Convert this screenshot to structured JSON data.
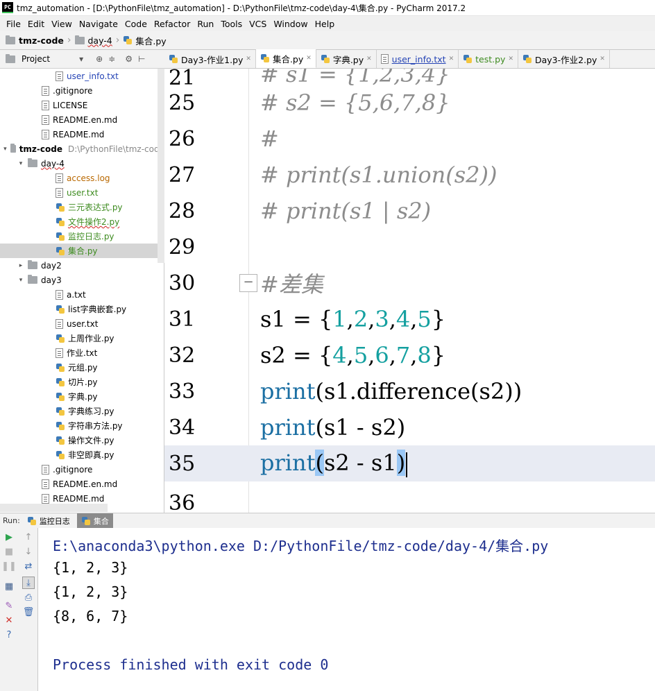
{
  "window": {
    "title": "tmz_automation - [D:\\PythonFile\\tmz_automation] - D:\\PythonFile\\tmz-code\\day-4\\集合.py - PyCharm 2017.2",
    "app_icon": "PC"
  },
  "menu": [
    {
      "label": "File"
    },
    {
      "label": "Edit"
    },
    {
      "label": "View"
    },
    {
      "label": "Navigate"
    },
    {
      "label": "Code"
    },
    {
      "label": "Refactor"
    },
    {
      "label": "Run"
    },
    {
      "label": "Tools"
    },
    {
      "label": "VCS"
    },
    {
      "label": "Window"
    },
    {
      "label": "Help"
    }
  ],
  "breadcrumb": [
    "tmz-code",
    "day-4",
    "集合.py"
  ],
  "project_panel": {
    "title": "Project",
    "tree": [
      {
        "label": "user_info.txt",
        "indent": 3,
        "icon": "txt-icon",
        "color": "blue"
      },
      {
        "label": ".gitignore",
        "indent": 2,
        "icon": "txt-icon"
      },
      {
        "label": "LICENSE",
        "indent": 2,
        "icon": "txt-icon"
      },
      {
        "label": "README.en.md",
        "indent": 2,
        "icon": "txt-icon"
      },
      {
        "label": "README.md",
        "indent": 2,
        "icon": "txt-icon"
      },
      {
        "label": "tmz-code",
        "indent": 0,
        "icon": "folder-icon",
        "arrow": "▾",
        "bold": true,
        "hint": "D:\\PythonFile\\tmz-code"
      },
      {
        "label": "day-4",
        "indent": 1,
        "icon": "folder-icon",
        "arrow": "▾",
        "wavy": true
      },
      {
        "label": "access.log",
        "indent": 3,
        "icon": "txt-icon",
        "color": "orange"
      },
      {
        "label": "user.txt",
        "indent": 3,
        "icon": "txt-icon",
        "color": "green"
      },
      {
        "label": "三元表达式.py",
        "indent": 3,
        "icon": "py-icon",
        "color": "green"
      },
      {
        "label": "文件操作2.py",
        "indent": 3,
        "icon": "py-icon",
        "color": "green",
        "wavy": true
      },
      {
        "label": "监控日志.py",
        "indent": 3,
        "icon": "py-icon",
        "color": "green"
      },
      {
        "label": "集合.py",
        "indent": 3,
        "icon": "py-icon",
        "color": "green",
        "selected": true
      },
      {
        "label": "day2",
        "indent": 1,
        "icon": "folder-icon",
        "arrow": "▸"
      },
      {
        "label": "day3",
        "indent": 1,
        "icon": "folder-icon",
        "arrow": "▾"
      },
      {
        "label": "a.txt",
        "indent": 3,
        "icon": "txt-icon"
      },
      {
        "label": "list字典嵌套.py",
        "indent": 3,
        "icon": "py-icon"
      },
      {
        "label": "user.txt",
        "indent": 3,
        "icon": "txt-icon"
      },
      {
        "label": "上周作业.py",
        "indent": 3,
        "icon": "py-icon"
      },
      {
        "label": "作业.txt",
        "indent": 3,
        "icon": "txt-icon"
      },
      {
        "label": "元组.py",
        "indent": 3,
        "icon": "py-icon"
      },
      {
        "label": "切片.py",
        "indent": 3,
        "icon": "py-icon"
      },
      {
        "label": "字典.py",
        "indent": 3,
        "icon": "py-icon"
      },
      {
        "label": "字典练习.py",
        "indent": 3,
        "icon": "py-icon"
      },
      {
        "label": "字符串方法.py",
        "indent": 3,
        "icon": "py-icon"
      },
      {
        "label": "操作文件.py",
        "indent": 3,
        "icon": "py-icon"
      },
      {
        "label": "非空即真.py",
        "indent": 3,
        "icon": "py-icon"
      },
      {
        "label": ".gitignore",
        "indent": 2,
        "icon": "txt-icon"
      },
      {
        "label": "README.en.md",
        "indent": 2,
        "icon": "txt-icon"
      },
      {
        "label": "README.md",
        "indent": 2,
        "icon": "txt-icon"
      }
    ]
  },
  "editor_tabs": [
    {
      "label": "Day3-作业1.py",
      "icon": "py-icon"
    },
    {
      "label": "集合.py",
      "icon": "py-icon",
      "active": true
    },
    {
      "label": "字典.py",
      "icon": "py-icon"
    },
    {
      "label": "user_info.txt",
      "icon": "txt-icon",
      "color": "blue"
    },
    {
      "label": "test.py",
      "icon": "py-icon",
      "color": "green"
    },
    {
      "label": "Day3-作业2.py",
      "icon": "py-icon"
    }
  ],
  "editor": {
    "lines": [
      {
        "num": "25",
        "tokens": [
          [
            "cm",
            "# s2 = {5,6,7,8}"
          ]
        ]
      },
      {
        "num": "26",
        "tokens": [
          [
            "cm",
            "#"
          ]
        ]
      },
      {
        "num": "27",
        "tokens": [
          [
            "cm",
            "# print(s1.union(s2))"
          ]
        ]
      },
      {
        "num": "28",
        "tokens": [
          [
            "cm",
            "# print(s1 | s2)"
          ]
        ]
      },
      {
        "num": "29",
        "tokens": []
      },
      {
        "num": "30",
        "tokens": [
          [
            "cm",
            "#差集"
          ]
        ],
        "fold": true
      },
      {
        "num": "31",
        "tokens": [
          [
            "",
            "s1 = {"
          ],
          [
            "num",
            "1"
          ],
          [
            "",
            ","
          ],
          [
            "num",
            "2"
          ],
          [
            "",
            ","
          ],
          [
            "num",
            "3"
          ],
          [
            "",
            ","
          ],
          [
            "num",
            "4"
          ],
          [
            "",
            ","
          ],
          [
            "num",
            "5"
          ],
          [
            "",
            "}"
          ]
        ]
      },
      {
        "num": "32",
        "tokens": [
          [
            "",
            "s2 = {"
          ],
          [
            "num",
            "4"
          ],
          [
            "",
            ","
          ],
          [
            "num",
            "5"
          ],
          [
            "",
            ","
          ],
          [
            "num",
            "6"
          ],
          [
            "",
            ","
          ],
          [
            "num",
            "7"
          ],
          [
            "",
            ","
          ],
          [
            "num",
            "8"
          ],
          [
            "",
            "}"
          ]
        ]
      },
      {
        "num": "33",
        "tokens": [
          [
            "kw",
            "print"
          ],
          [
            "",
            "(s1.difference(s2))"
          ]
        ]
      },
      {
        "num": "34",
        "tokens": [
          [
            "kw",
            "print"
          ],
          [
            "",
            "(s1 - s2)"
          ]
        ]
      },
      {
        "num": "35",
        "tokens": [
          [
            "kw",
            "print"
          ],
          [
            "hl",
            "("
          ],
          [
            "",
            "s2 - s1"
          ],
          [
            "hl",
            ")"
          ]
        ],
        "current": true,
        "caret": true
      }
    ]
  },
  "run_panel": {
    "label": "Run:",
    "tabs": [
      {
        "label": "监控日志",
        "active": false
      },
      {
        "label": "集合",
        "active": true
      }
    ],
    "console": [
      {
        "text": "E:\\anaconda3\\python.exe D:/PythonFile/tmz-code/day-4/集合.py",
        "kind": "cmd"
      },
      {
        "text": "{1, 2, 3}",
        "kind": "out"
      },
      {
        "text": "{1, 2, 3}",
        "kind": "out"
      },
      {
        "text": "{8, 6, 7}",
        "kind": "out"
      },
      {
        "text": "",
        "kind": "out"
      },
      {
        "text": "Process finished with exit code 0",
        "kind": "exit"
      }
    ]
  }
}
